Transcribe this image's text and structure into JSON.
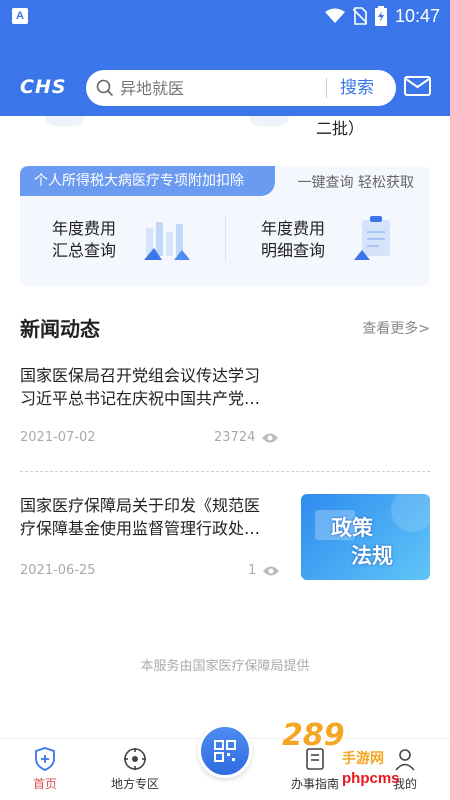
{
  "status_bar": {
    "time": "10:47",
    "app_badge": "A"
  },
  "header": {
    "logo": "CHS",
    "search_placeholder": "异地就医",
    "search_button": "搜索"
  },
  "partial_banner": {
    "visible_text": "二批）"
  },
  "card": {
    "ribbon": "个人所得税大病医疗专项附加扣除",
    "slogan": "一键查询 轻松获取",
    "items": [
      {
        "line1": "年度费用",
        "line2": "汇总查询"
      },
      {
        "line1": "年度费用",
        "line2": "明细查询"
      }
    ]
  },
  "news": {
    "title": "新闻动态",
    "more": "查看更多>",
    "items": [
      {
        "line1": "国家医保局召开党组会议传达学习",
        "line2": "习近平总书记在庆祝中国共产党…",
        "date": "2021-07-02",
        "views": "23724"
      },
      {
        "line1": "国家医疗保障局关于印发《规范医",
        "line2": "疗保障基金使用监督管理行政处…",
        "date": "2021-06-25",
        "views": "1",
        "thumb_text1": "政策",
        "thumb_text2": "法规"
      }
    ]
  },
  "footer_note": "本服务由国家医疗保障局提供",
  "tabs": [
    {
      "label": "首页",
      "icon": "shield-plus-icon",
      "active": true
    },
    {
      "label": "地方专区",
      "icon": "target-icon",
      "active": false
    },
    {
      "label": "办事指南",
      "icon": "guide-icon",
      "active": false
    },
    {
      "label": "我的",
      "icon": "user-icon",
      "active": false
    }
  ],
  "center_button": {
    "icon": "qr-scan-icon"
  },
  "watermark": {
    "text1": "289",
    "text2": "手游网",
    "text3": "phpcms"
  },
  "colors": {
    "brand_blue": "#3a76e9",
    "active_tab": "#d9534f",
    "ribbon": "#6b9bf0"
  }
}
